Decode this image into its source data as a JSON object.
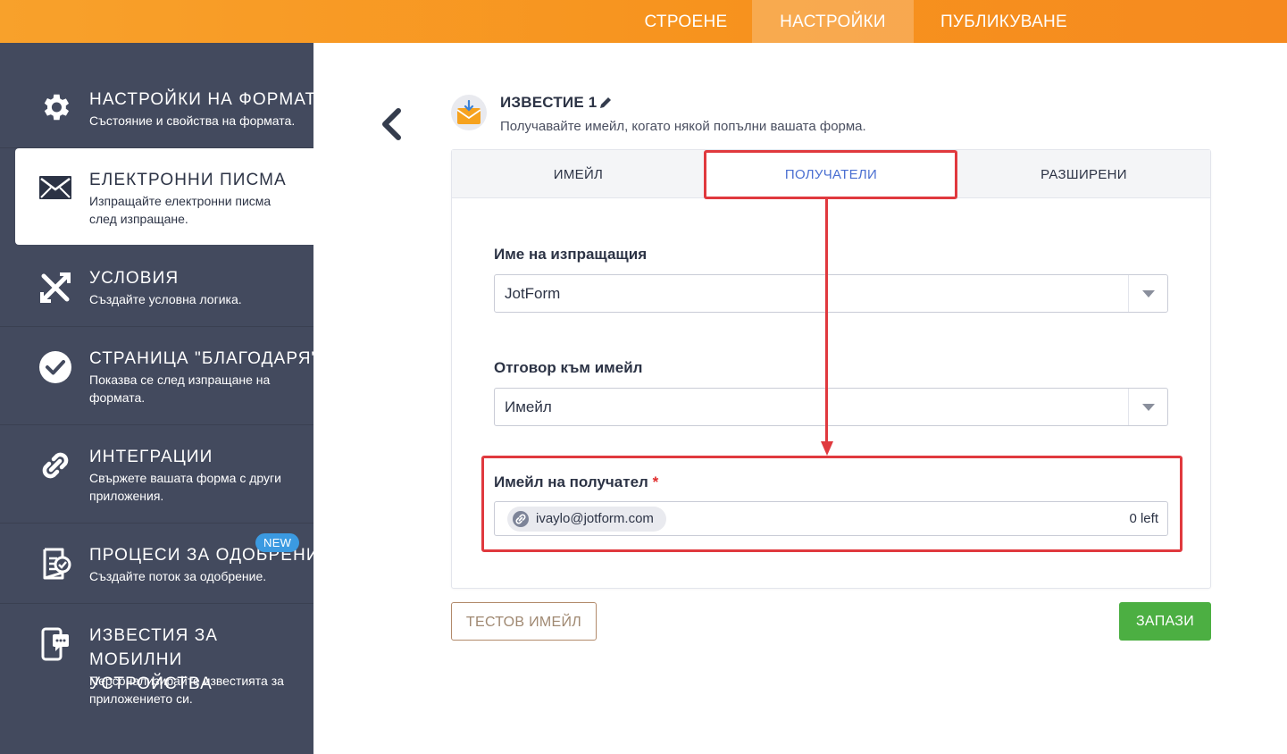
{
  "topnav": {
    "tabs": [
      {
        "label": "СТРОЕНЕ"
      },
      {
        "label": "НАСТРОЙКИ"
      },
      {
        "label": "ПУБЛИКУВАНЕ"
      }
    ],
    "active_tab": "НАСТРОЙКИ"
  },
  "sidebar": {
    "items": [
      {
        "title": "НАСТРОЙКИ НА ФОРМАТА",
        "desc": "Състояние и свойства на формата.",
        "icon": "gear-icon"
      },
      {
        "title": "ЕЛЕКТРОННИ ПИСМА",
        "desc": "Изпращайте електронни писма след изпращане.",
        "icon": "envelope-icon"
      },
      {
        "title": "УСЛОВИЯ",
        "desc": "Създайте условна логика.",
        "icon": "conditions-icon"
      },
      {
        "title": "СТРАНИЦА \"БЛАГОДАРЯ\"",
        "desc": "Показва се след изпращане на формата.",
        "icon": "check-circle-icon"
      },
      {
        "title": "ИНТЕГРАЦИИ",
        "desc": "Свържете вашата форма с други приложения.",
        "icon": "link-icon"
      },
      {
        "title": "ПРОЦЕСИ ЗА ОДОБРЕНИЕ",
        "desc": "Създайте поток за одобрение.",
        "icon": "approval-icon",
        "badge": "NEW"
      },
      {
        "title": "ИЗВЕСТИЯ ЗА МОБИЛНИ УСТРОЙСТВА",
        "desc": "Персонализирайте известията за приложението си.",
        "icon": "mobile-notification-icon"
      }
    ],
    "active_index": 1
  },
  "notification": {
    "title": "ИЗВЕСТИЕ 1",
    "subtitle": "Получавайте имейл, когато някой попълни вашата форма."
  },
  "card": {
    "tabs": [
      {
        "label": "ИМЕЙЛ"
      },
      {
        "label": "ПОЛУЧАТЕЛИ"
      },
      {
        "label": "РАЗШИРЕНИ"
      }
    ],
    "active_tab": "ПОЛУЧАТЕЛИ",
    "sender_name": {
      "label": "Име на изпращащия",
      "value": "JotForm"
    },
    "reply_to": {
      "label": "Отговор към имейл",
      "value": "Имейл"
    },
    "recipient": {
      "label": "Имейл на получател",
      "required_mark": "*",
      "email": "ivaylo@jotform.com",
      "left_count": "0 left"
    }
  },
  "buttons": {
    "test_email": "ТЕСТОВ ИМЕЙЛ",
    "save": "ЗАПАЗИ"
  },
  "colors": {
    "topbar": "#f7931e",
    "sidebar": "#434a5e",
    "active_tab_text": "#4a6fd1",
    "save_button": "#4caf42",
    "annotation": "#e0393e",
    "badge": "#3b9ae1"
  }
}
